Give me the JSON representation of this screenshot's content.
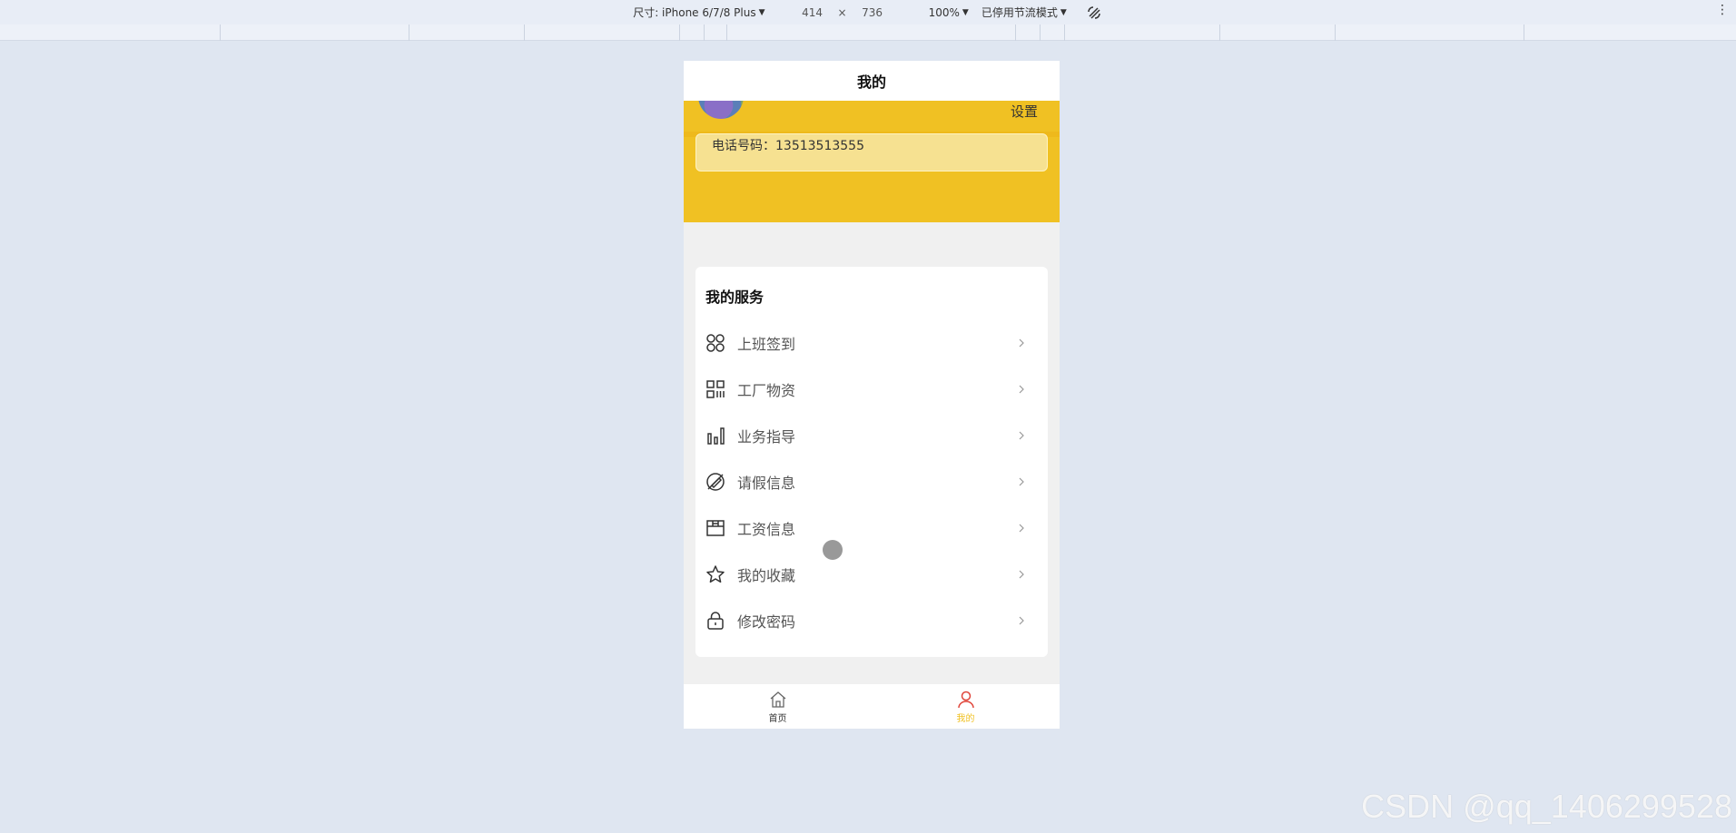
{
  "devtools": {
    "device_label": "尺寸: iPhone 6/7/8 Plus",
    "width": "414",
    "times": "×",
    "height": "736",
    "zoom": "100%",
    "throttle": "已停用节流模式"
  },
  "nav": {
    "title": "我的"
  },
  "header": {
    "settings_label": "设置",
    "phone_text": "电话号码：13513513555",
    "color": "#f0c123"
  },
  "services": {
    "title": "我的服务",
    "items": [
      {
        "label": "上班签到",
        "icon": "apps-grid-icon"
      },
      {
        "label": "工厂物资",
        "icon": "qrcode-icon"
      },
      {
        "label": "业务指导",
        "icon": "bar-chart-icon"
      },
      {
        "label": "请假信息",
        "icon": "no-edit-icon"
      },
      {
        "label": "工资信息",
        "icon": "box-icon"
      },
      {
        "label": "我的收藏",
        "icon": "star-icon"
      },
      {
        "label": "修改密码",
        "icon": "lock-icon"
      }
    ]
  },
  "tabbar": {
    "tabs": [
      {
        "label": "首页",
        "icon": "home-icon",
        "active": false
      },
      {
        "label": "我的",
        "icon": "user-icon",
        "active": true
      }
    ],
    "active_color": "#f0c123"
  },
  "watermark": "CSDN @qq_1406299528"
}
